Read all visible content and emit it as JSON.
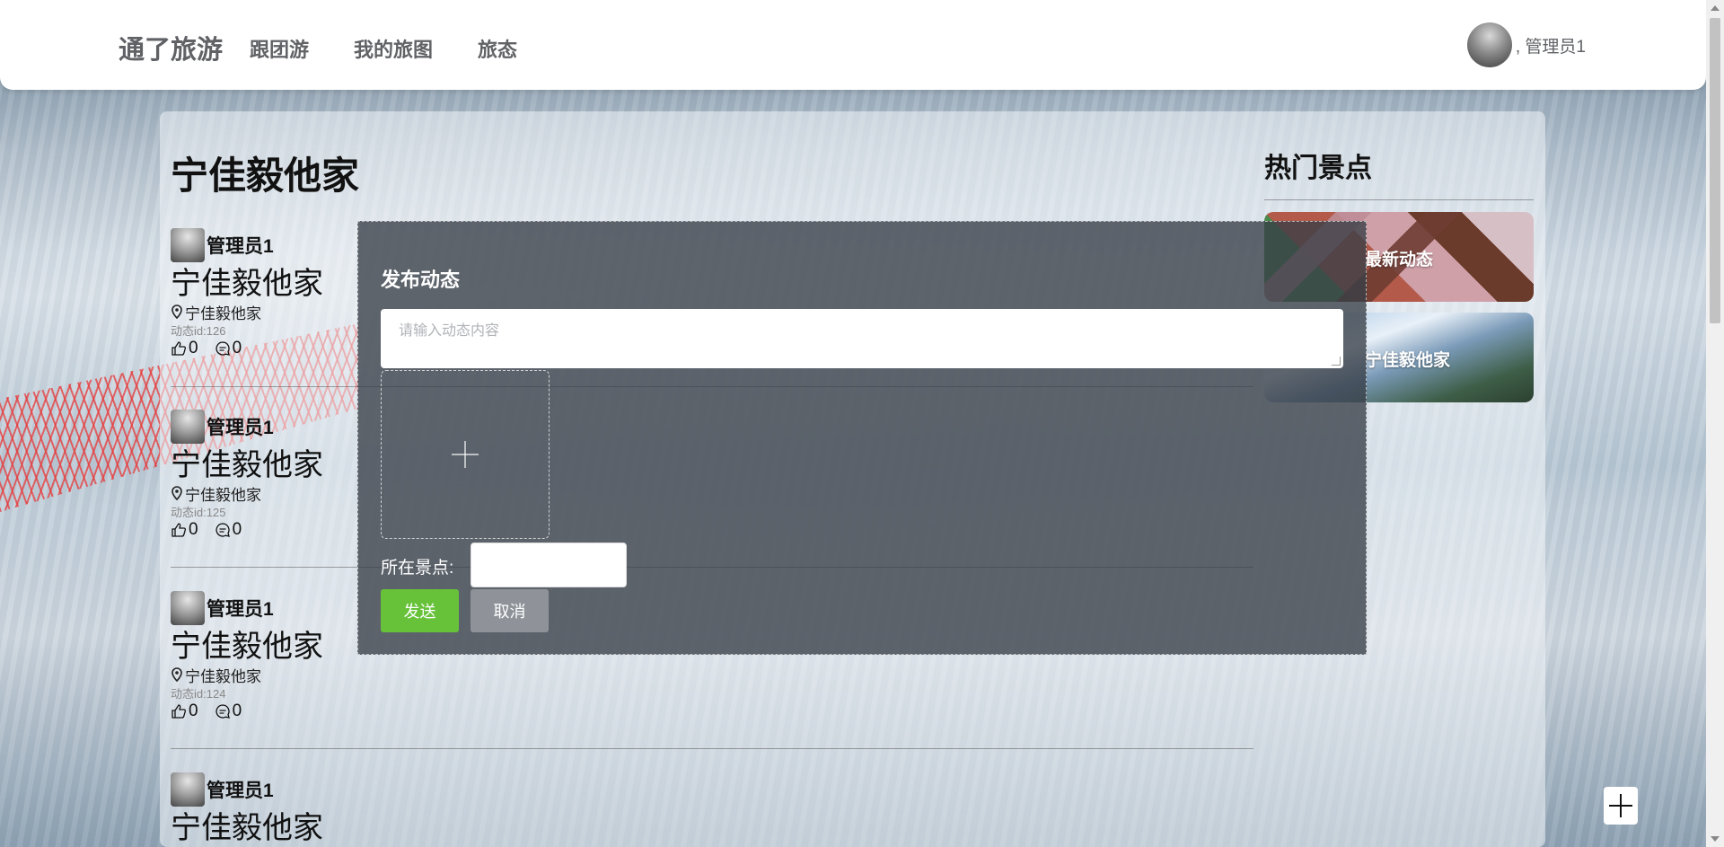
{
  "header": {
    "brand": "通了旅游",
    "nav": [
      "跟团游",
      "我的旅图",
      "旅态"
    ],
    "user_name": ", 管理员1"
  },
  "page": {
    "title": "宁佳毅他家"
  },
  "posts": [
    {
      "user": "管理员1",
      "title": "宁佳毅他家",
      "location": "宁佳毅他家",
      "id_text": "动态id:126",
      "likes": "0",
      "comments": "0"
    },
    {
      "user": "管理员1",
      "title": "宁佳毅他家",
      "location": "宁佳毅他家",
      "id_text": "动态id:125",
      "likes": "0",
      "comments": "0"
    },
    {
      "user": "管理员1",
      "title": "宁佳毅他家",
      "location": "宁佳毅他家",
      "id_text": "动态id:124",
      "likes": "0",
      "comments": "0"
    },
    {
      "user": "管理员1",
      "title": "宁佳毅他家"
    }
  ],
  "hot": {
    "title": "热门景点",
    "cards": [
      "最新动态",
      "宁佳毅他家"
    ]
  },
  "modal": {
    "title": "发布动态",
    "placeholder": "请输入动态内容",
    "spot_label": "所在景点:",
    "send": "发送",
    "cancel": "取消"
  },
  "icons": {
    "location": "location-pin-icon",
    "like": "thumbs-up-icon",
    "comment": "comment-icon",
    "add": "plus-icon"
  },
  "colors": {
    "send": "#67c23a",
    "cancel": "#8f9399"
  }
}
